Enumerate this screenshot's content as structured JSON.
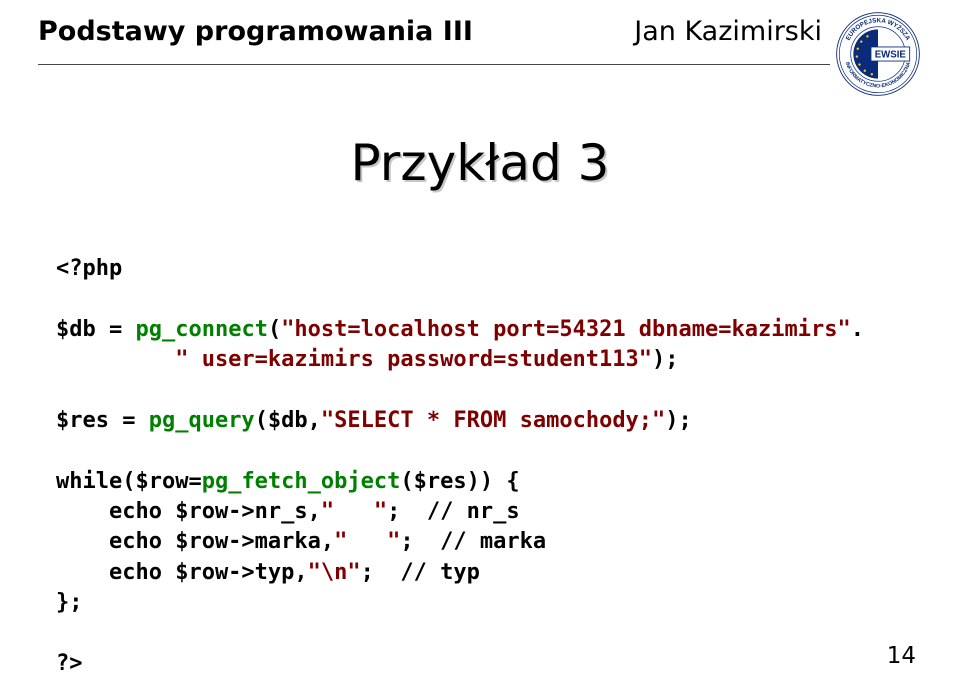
{
  "header": {
    "course_title": "Podstawy programowania III",
    "author": "Jan Kazimirski",
    "logo": {
      "badge_text": "EWSIE",
      "ring_top": "EUROPEJSKA WYŻSZA",
      "ring_bottom": "INFORMATYCZNO-EKONOMICZNA"
    }
  },
  "slide_title": "Przykład 3",
  "code": {
    "open_tag": "<?php",
    "l1_a": "$db = ",
    "l1_fn": "pg_connect",
    "l1_b": "(",
    "l1_str": "\"host=localhost port=54321 dbname=kazimirs\"",
    "l1_c": ".",
    "l2_str": "         \" user=kazimirs password=student113\"",
    "l2_b": ");",
    "l3_a": "$res = ",
    "l3_fn": "pg_query",
    "l3_b": "($db,",
    "l3_str": "\"SELECT * FROM samochody;\"",
    "l3_c": ");",
    "l4_a": "while($row=",
    "l4_fn": "pg_fetch_object",
    "l4_b": "($res)) {",
    "l5_a": "    echo $row->nr_s,",
    "l5_str": "\"   \"",
    "l5_b": ";  // nr_s",
    "l6_a": "    echo $row->marka,",
    "l6_str": "\"   \"",
    "l6_b": ";  // marka",
    "l7_a": "    echo $row->typ,",
    "l7_str": "\"\\n\"",
    "l7_b": ";  // typ",
    "l8": "};",
    "close_tag": "?>"
  },
  "page_number": "14"
}
